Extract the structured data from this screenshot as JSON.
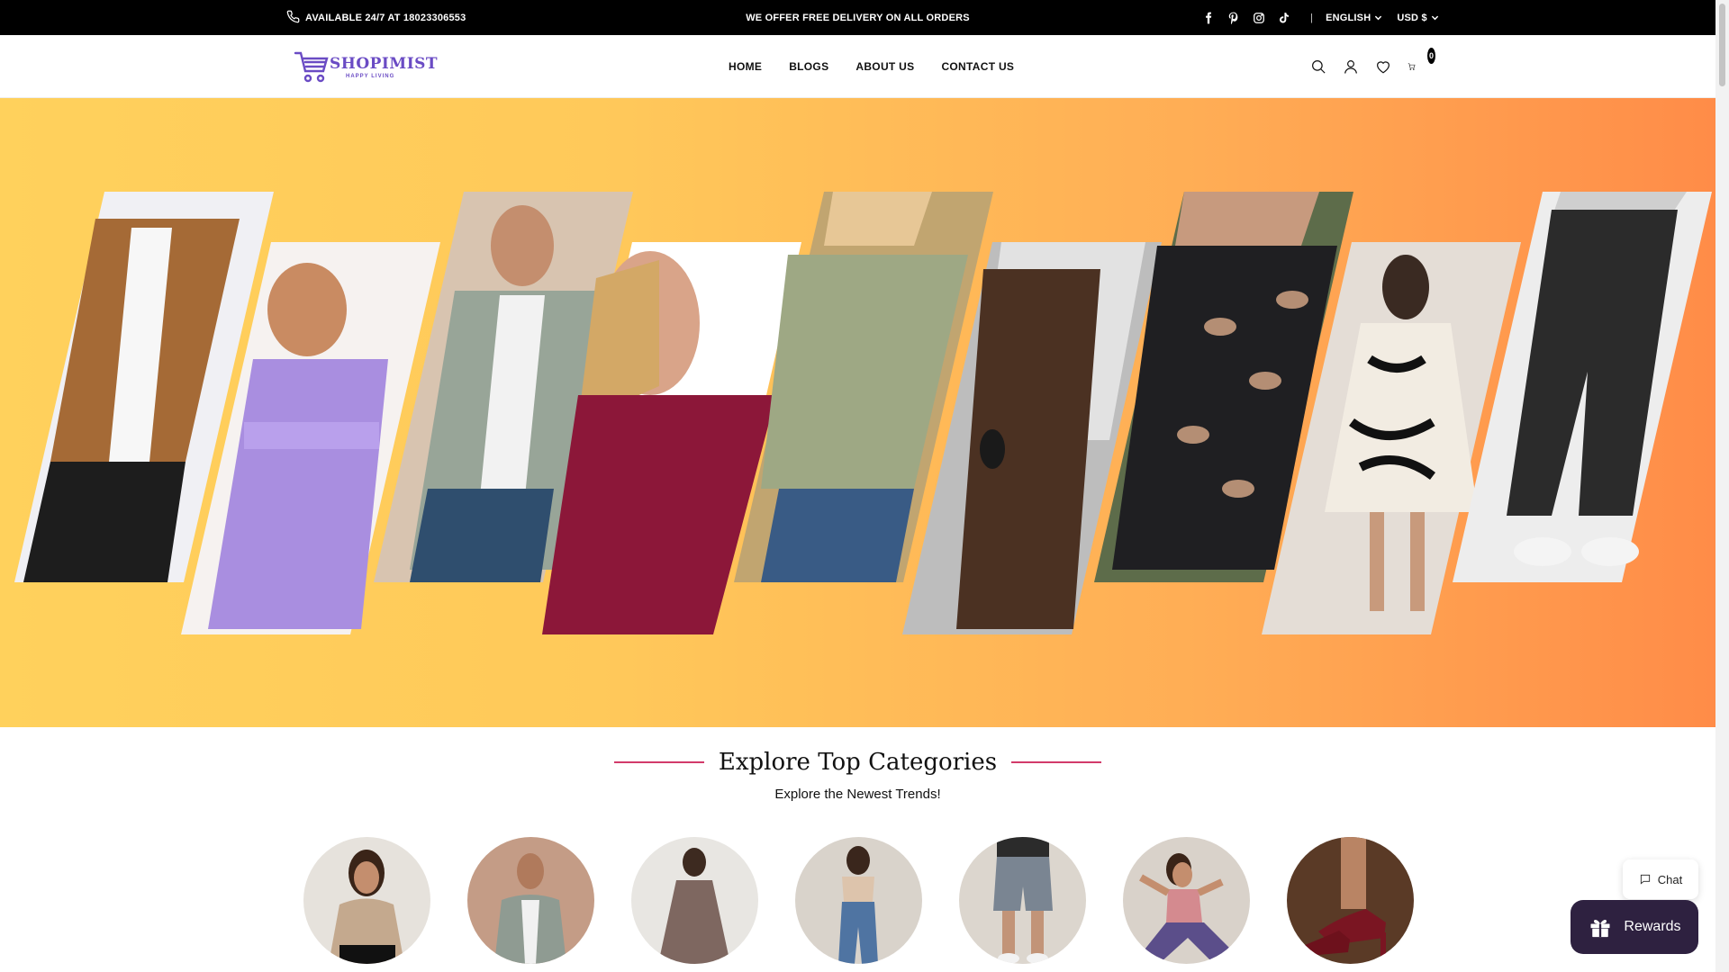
{
  "announcement": {
    "phone_text": "AVAILABLE 24/7 AT 18023306553",
    "offer_text": "WE OFFER FREE DELIVERY ON ALL ORDERS",
    "social": [
      "facebook-icon",
      "pinterest-icon",
      "instagram-icon",
      "tiktok-icon"
    ],
    "language": "ENGLISH",
    "currency": "USD $"
  },
  "header": {
    "logo_text": "SHOPIMIST",
    "logo_tagline": "HAPPY LIVING",
    "nav": [
      "HOME",
      "BLOGS",
      "ABOUT US",
      "CONTACT US"
    ],
    "cart_count": "0",
    "icons": [
      "search-icon",
      "account-icon",
      "wishlist-icon",
      "cart-icon"
    ]
  },
  "hero": {
    "colors": {
      "gradient_start": "#ffd15c",
      "gradient_end": "#ff8c48"
    },
    "panels": [
      "jacket",
      "purple-dress",
      "plaid-shirt",
      "burgundy-top",
      "floral-top",
      "brown-dress",
      "patterned-top",
      "print-dress",
      "leggings"
    ]
  },
  "categories": {
    "title": "Explore Top Categories",
    "subtitle": "Explore the Newest Trends!",
    "items": [
      "beige-tee",
      "men-shirt",
      "mauve-dress",
      "jeans-look",
      "shorts",
      "activewear",
      "heels"
    ]
  },
  "widgets": {
    "chat_label": "Chat",
    "rewards_label": "Rewards"
  },
  "colors": {
    "accent_line": "#d23a6a",
    "rewards_bg": "#2e2140",
    "topbar_bg": "#000000"
  }
}
